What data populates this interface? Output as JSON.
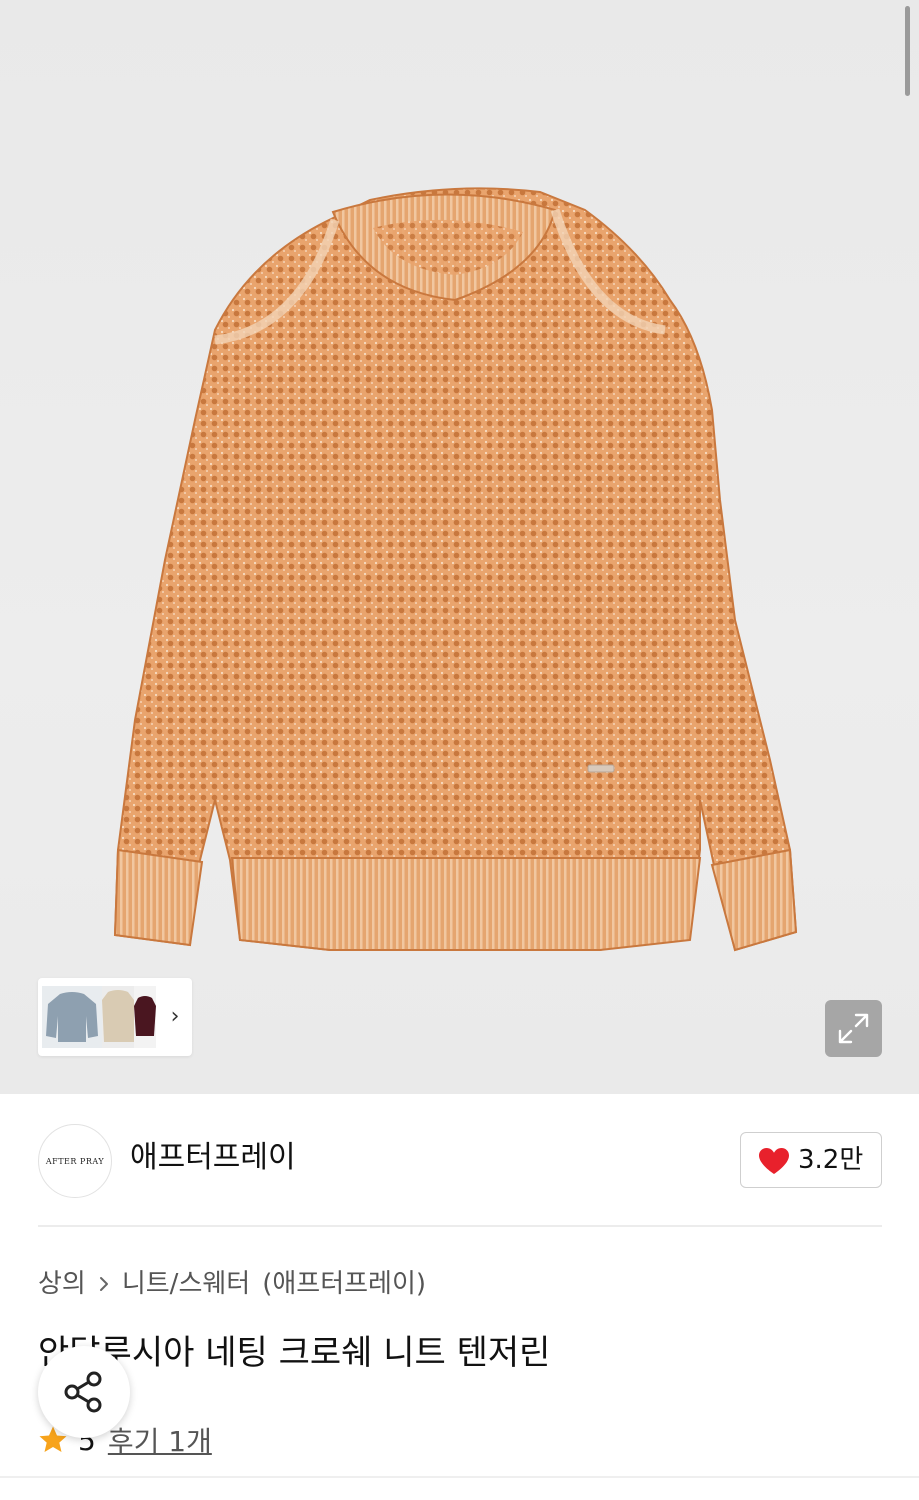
{
  "brand": {
    "logo_text": "AFTER PRAY",
    "name": "애프터프레이"
  },
  "likes": {
    "count": "3.2만"
  },
  "gallery": {
    "next_label": "›"
  },
  "breadcrumb": {
    "category": "상의",
    "subcategory": "니트/스웨터",
    "brand_paren": "(애프터프레이)"
  },
  "product": {
    "title": "안달루시아 네팅 크로쉐 니트 텐저린"
  },
  "rating": {
    "value": "5",
    "reviews_label": "후기 1개"
  },
  "colors": {
    "sweater": "#e8a56f",
    "heart": "#e8212c",
    "star": "#f7a31b"
  }
}
